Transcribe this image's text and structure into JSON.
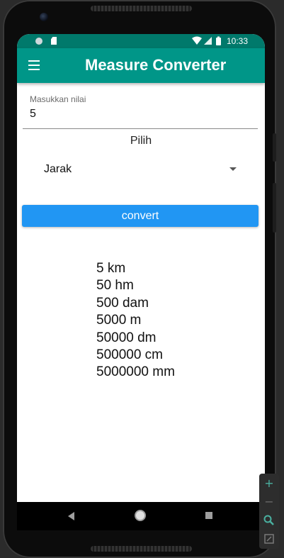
{
  "status_bar": {
    "time": "10:33",
    "icons": [
      "notification-dot-icon",
      "sd-card-icon",
      "wifi-icon",
      "signal-icon",
      "battery-icon"
    ]
  },
  "app_bar": {
    "menu_icon": "hamburger-menu-icon",
    "title": "Measure Converter",
    "color": "#009688",
    "status_color": "#00796b"
  },
  "input": {
    "label": "Masukkan nilai",
    "value": "5"
  },
  "pilih_label": "Pilih",
  "dropdown": {
    "selected": "Jarak"
  },
  "convert_button": {
    "label": "convert",
    "color": "#2196f3"
  },
  "results": [
    "5 km",
    "50 hm",
    "500 dam",
    "5000 m",
    "50000 dm",
    "500000 cm",
    "5000000 mm"
  ],
  "nav_bar": {
    "icons": [
      "back-icon",
      "home-icon",
      "recents-icon"
    ]
  },
  "zoom_controls": {
    "icons": [
      "zoom-in-icon",
      "zoom-out-icon",
      "zoom-search-icon",
      "fit-screen-icon"
    ]
  }
}
